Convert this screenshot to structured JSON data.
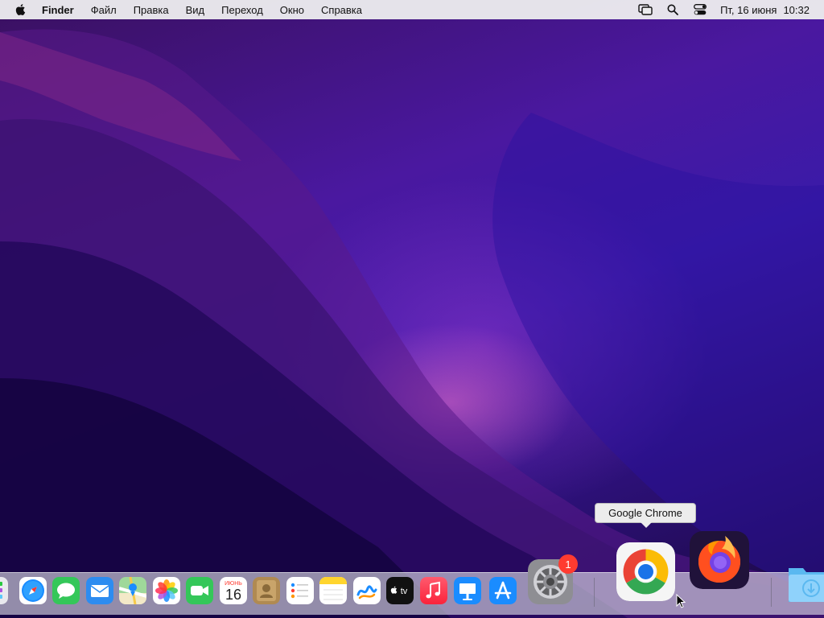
{
  "menubar": {
    "app_name": "Finder",
    "menus": [
      "Файл",
      "Правка",
      "Вид",
      "Переход",
      "Окно",
      "Справка"
    ],
    "status_icons": [
      "screen-mirroring-icon",
      "spotlight-search-icon",
      "control-center-icon"
    ],
    "clock": {
      "date": "Пт, 16 июня",
      "time": "10:32"
    }
  },
  "dock": {
    "tooltip": "Google Chrome",
    "calendar": {
      "month": "ИЮНЬ",
      "day": "16"
    },
    "apple_tv_label": "tv",
    "settings_badge": "1",
    "apps": [
      "launchpad",
      "safari",
      "messages",
      "mail",
      "maps",
      "photos",
      "facetime",
      "calendar",
      "contacts",
      "reminders",
      "notes",
      "freeform",
      "apple-tv",
      "music",
      "keynote",
      "app-store",
      "system-settings",
      "google-chrome",
      "firefox",
      "downloads"
    ]
  },
  "colors": {
    "accent_blue": "#1a8cff",
    "badge_red": "#ff3b30",
    "menubar_bg": "#ececee"
  }
}
